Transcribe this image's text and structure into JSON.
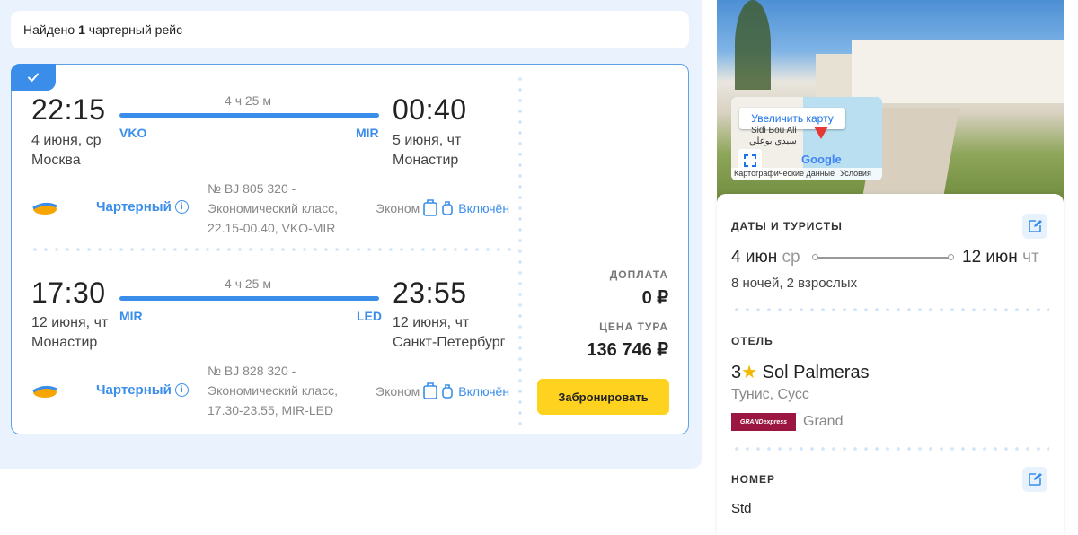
{
  "results": {
    "found_prefix": "Найдено",
    "found_count": "1",
    "found_suffix": "чартерный рейс"
  },
  "flights": [
    {
      "dep_time": "22:15",
      "dep_date": "4 июня, ср",
      "dep_city": "Москва",
      "dep_code": "VKO",
      "duration": "4 ч 25 м",
      "arr_code": "MIR",
      "arr_time": "00:40",
      "arr_date": "5 июня, чт",
      "arr_city": "Монастир",
      "type": "Чартерный",
      "info_line1": "№ BJ 805 320 -",
      "info_line2": "Экономический класс,",
      "info_line3": "22.15-00.40, VKO-MIR",
      "class": "Эконом",
      "baggage": "Включён"
    },
    {
      "dep_time": "17:30",
      "dep_date": "12 июня, чт",
      "dep_city": "Монастир",
      "dep_code": "MIR",
      "duration": "4 ч 25 м",
      "arr_code": "LED",
      "arr_time": "23:55",
      "arr_date": "12 июня, чт",
      "arr_city": "Санкт-Петербург",
      "type": "Чартерный",
      "info_line1": "№ BJ 828 320 -",
      "info_line2": "Экономический класс,",
      "info_line3": "17.30-23.55, MIR-LED",
      "class": "Эконом",
      "baggage": "Включён"
    }
  ],
  "pricing": {
    "surcharge_label": "ДОПЛАТА",
    "surcharge_value": "0 ₽",
    "tour_price_label": "ЦЕНА ТУРА",
    "tour_price_value": "136 746 ₽",
    "book_button": "Забронировать"
  },
  "map": {
    "enlarge_button": "Увеличить карту",
    "place_name": "Sidi Bou Ali",
    "place_name_ar": "سيدي بوعلي",
    "logo": "Google",
    "footer_data": "Картографические данные",
    "footer_terms": "Условия"
  },
  "sidebar": {
    "dates_label": "ДАТЫ И ТУРИСТЫ",
    "start_date": "4 июн",
    "start_dow": "ср",
    "end_date": "12 июн",
    "end_dow": "чт",
    "nights_tourists": "8 ночей, 2 взрослых",
    "hotel_label": "ОТЕЛЬ",
    "hotel_stars": "3",
    "hotel_name": "Sol Palmeras",
    "hotel_location": "Тунис, Сусс",
    "brand_logo_text": "GRANDexpress",
    "brand_name": "Grand",
    "room_label": "НОМЕР",
    "room_value": "Std"
  },
  "colors": {
    "accent": "#3a8eea",
    "button": "#ffd21f",
    "star": "#f3b700",
    "brand": "#9b1640"
  }
}
